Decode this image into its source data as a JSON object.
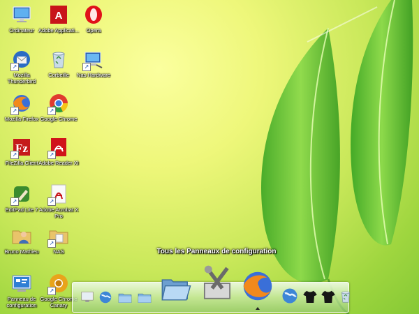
{
  "desktop": {
    "icons": [
      {
        "label": "Ordinateur",
        "icon": "computer-icon",
        "shortcut": false
      },
      {
        "label": "Adobe Applicati...",
        "icon": "adobe-application-icon",
        "shortcut": false
      },
      {
        "label": "Opera",
        "icon": "opera-icon",
        "shortcut": false
      },
      {
        "label": "Mozilla Thunderbird",
        "icon": "thunderbird-icon",
        "shortcut": true
      },
      {
        "label": "Corbeille",
        "icon": "recycle-bin-icon",
        "shortcut": false
      },
      {
        "label": "Nas Hardware",
        "icon": "network-computer-icon",
        "shortcut": true
      },
      {
        "label": "Mozilla Firefox",
        "icon": "firefox-icon",
        "shortcut": true
      },
      {
        "label": "Google Chrome",
        "icon": "chrome-icon",
        "shortcut": true
      },
      {
        "label": "FileZilla Client",
        "icon": "filezilla-icon",
        "shortcut": true
      },
      {
        "label": "Adobe Reader XI",
        "icon": "adobe-reader-icon",
        "shortcut": true
      },
      {
        "label": "EditPad Lite 7",
        "icon": "editpad-icon",
        "shortcut": true
      },
      {
        "label": "Adobe Acrobat X Pro",
        "icon": "acrobat-icon",
        "shortcut": true
      },
      {
        "label": "Bruno Mathieu",
        "icon": "user-folder-icon",
        "shortcut": false
      },
      {
        "label": "NAS",
        "icon": "nas-folder-icon",
        "shortcut": true
      },
      {
        "label": "Panneau de configuration",
        "icon": "control-panel-icon",
        "shortcut": false
      },
      {
        "label": "Google Chrome Canary",
        "icon": "chrome-canary-icon",
        "shortcut": true
      }
    ]
  },
  "dock": {
    "tooltip": "Tous les Panneaux de configuration",
    "items": [
      {
        "icon": "monitor-icon"
      },
      {
        "icon": "globe-icon"
      },
      {
        "icon": "folder-icon"
      },
      {
        "icon": "folder-icon"
      },
      {
        "icon": "open-folder-icon"
      },
      {
        "icon": "tools-icon"
      },
      {
        "icon": "firefox-icon"
      },
      {
        "icon": "globe-icon"
      },
      {
        "icon": "tshirt-icon"
      },
      {
        "icon": "tshirt-icon"
      },
      {
        "icon": "recycle-bin-icon"
      }
    ]
  },
  "colors": {
    "wallpaper_light": "#fbff9e",
    "wallpaper_dark": "#86c935",
    "leaf": "#4fb52c",
    "label_text": "#ffffff"
  }
}
